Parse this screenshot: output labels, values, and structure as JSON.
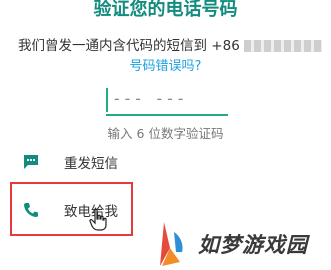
{
  "header": {
    "title": "验证您的电话号码"
  },
  "instruction": {
    "text": "我们曾发一通内含代码的短信到 +86"
  },
  "wrong_number_link": "号码错误吗?",
  "code_input": {
    "placeholder": "--- ---"
  },
  "hint": "输入 6 位数字验证码",
  "options": {
    "resend_sms": {
      "label": "重发短信",
      "icon": "message-icon"
    },
    "call_me": {
      "label": "致电给我",
      "icon": "phone-icon"
    }
  },
  "watermark": {
    "text": "如梦游戏园"
  },
  "colors": {
    "accent": "#128c7e",
    "link": "#1aa0e0",
    "highlight": "#e5393b"
  }
}
